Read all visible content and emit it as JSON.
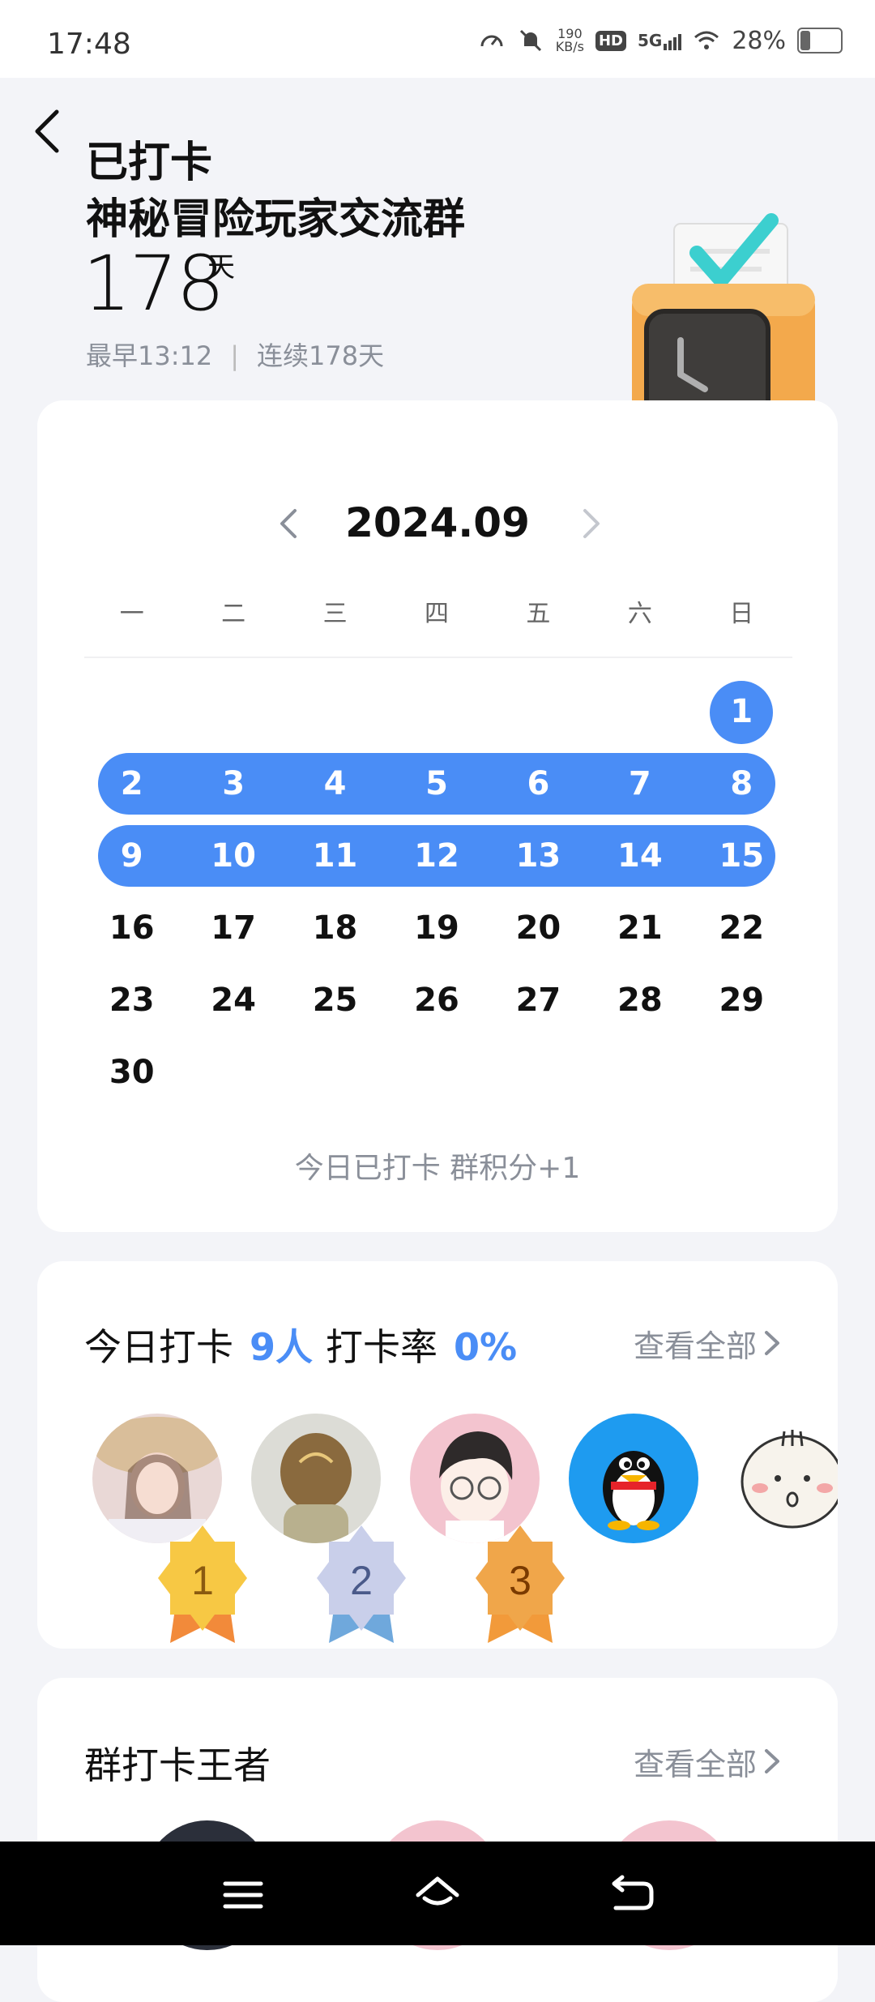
{
  "status_bar": {
    "time": "17:48",
    "net_speed": "190",
    "net_unit": "KB/s",
    "hd": "HD",
    "signal": "5G",
    "battery": "28%"
  },
  "header": {
    "back_icon": "chevron-left-icon",
    "line1": "已打卡",
    "line2": "神秘冒险玩家交流群",
    "days": "178",
    "days_unit": "天",
    "earliest": "最早13:12",
    "separator": "|",
    "streak": "连续178天"
  },
  "calendar": {
    "month": "2024.09",
    "weekdays": [
      "一",
      "二",
      "三",
      "四",
      "五",
      "六",
      "日"
    ],
    "rows": [
      [
        "",
        "",
        "",
        "",
        "",
        "",
        "1"
      ],
      [
        "2",
        "3",
        "4",
        "5",
        "6",
        "7",
        "8"
      ],
      [
        "9",
        "10",
        "11",
        "12",
        "13",
        "14",
        "15"
      ],
      [
        "16",
        "17",
        "18",
        "19",
        "20",
        "21",
        "22"
      ],
      [
        "23",
        "24",
        "25",
        "26",
        "27",
        "28",
        "29"
      ],
      [
        "30",
        "",
        "",
        "",
        "",
        "",
        ""
      ]
    ],
    "checked_days": [
      1,
      2,
      3,
      4,
      5,
      6,
      7,
      8,
      9,
      10,
      11,
      12,
      13,
      14,
      15
    ],
    "footer": "今日已打卡  群积分+1"
  },
  "today": {
    "label": "今日打卡",
    "count": "9人",
    "rate_label": "打卡率",
    "rate": "0%",
    "view_all": "查看全部",
    "badges": [
      "1",
      "2",
      "3"
    ]
  },
  "kings": {
    "title": "群打卡王者",
    "view_all": "查看全部"
  },
  "colors": {
    "accent": "#4A8DF6",
    "background": "#F3F4F8"
  }
}
